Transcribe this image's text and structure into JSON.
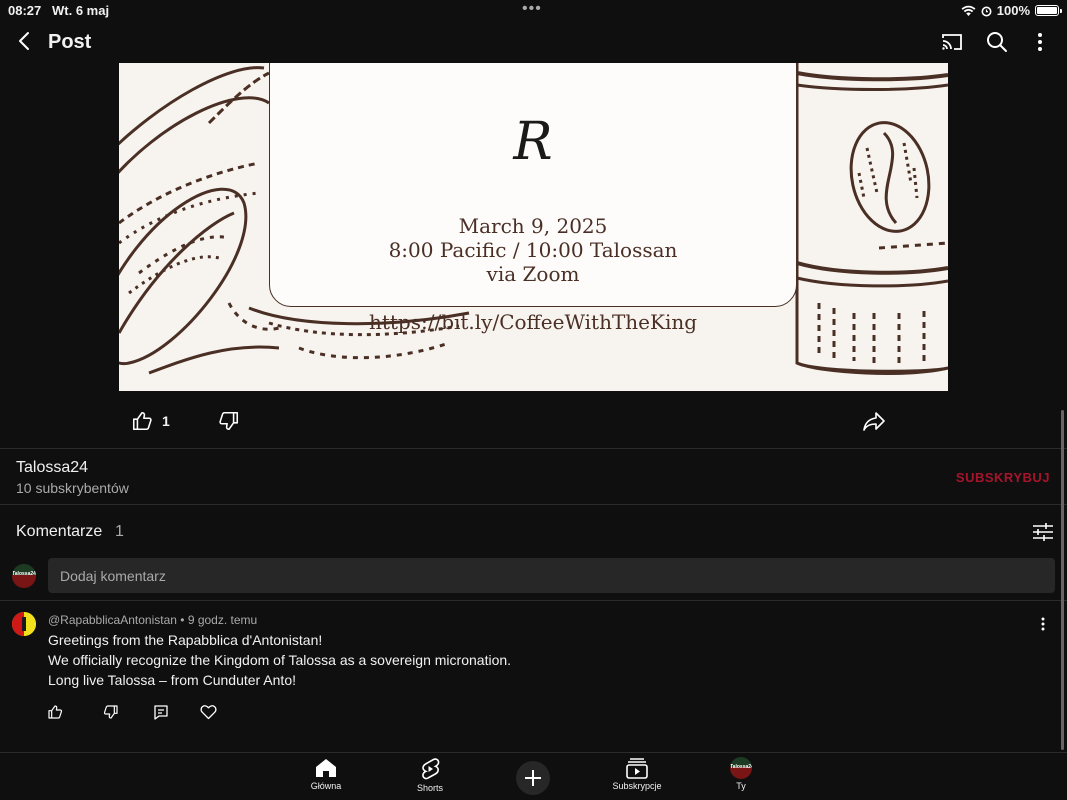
{
  "status_bar": {
    "time": "08:27",
    "date": "Wt. 6 maj",
    "battery": "100%"
  },
  "header": {
    "title": "Post",
    "icons": [
      "back-icon",
      "cast-icon",
      "search-icon",
      "more-vertical-icon"
    ]
  },
  "post_image": {
    "logo_letter": "R",
    "date_line": "March 9, 2025",
    "time_line": "8:00 Pacific / 10:00 Talossan",
    "via_line": "via Zoom",
    "url_line": "https://bit.ly/CoffeeWithTheKing"
  },
  "actions": {
    "like_count": "1"
  },
  "channel": {
    "name": "Talossa24",
    "subscribers": "10 subskrybentów",
    "subscribe_label": "SUBSKRYBUJ",
    "avatar_text": "Talossa24"
  },
  "comments": {
    "title": "Komentarze",
    "count": "1",
    "placeholder": "Dodaj komentarz",
    "items": [
      {
        "author": "@RapabblicaAntonistan",
        "time": "9 godz. temu",
        "lines": [
          "Greetings from the Rapabblica d'Antonistan!",
          "We officially recognize the Kingdom of Talossa as a sovereign micronation.",
          "Long live Talossa – from Cunduter Anto!"
        ]
      }
    ]
  },
  "bottom_nav": {
    "items": [
      {
        "label": "Główna",
        "icon": "home-icon"
      },
      {
        "label": "Shorts",
        "icon": "shorts-icon"
      },
      {
        "label": "Subskrypcje",
        "icon": "subscriptions-icon"
      },
      {
        "label": "Ty",
        "icon": "avatar"
      }
    ]
  },
  "colors": {
    "background": "#0f0f0f",
    "subscribe": "#a6142c",
    "card_ink": "#4a2f25"
  }
}
